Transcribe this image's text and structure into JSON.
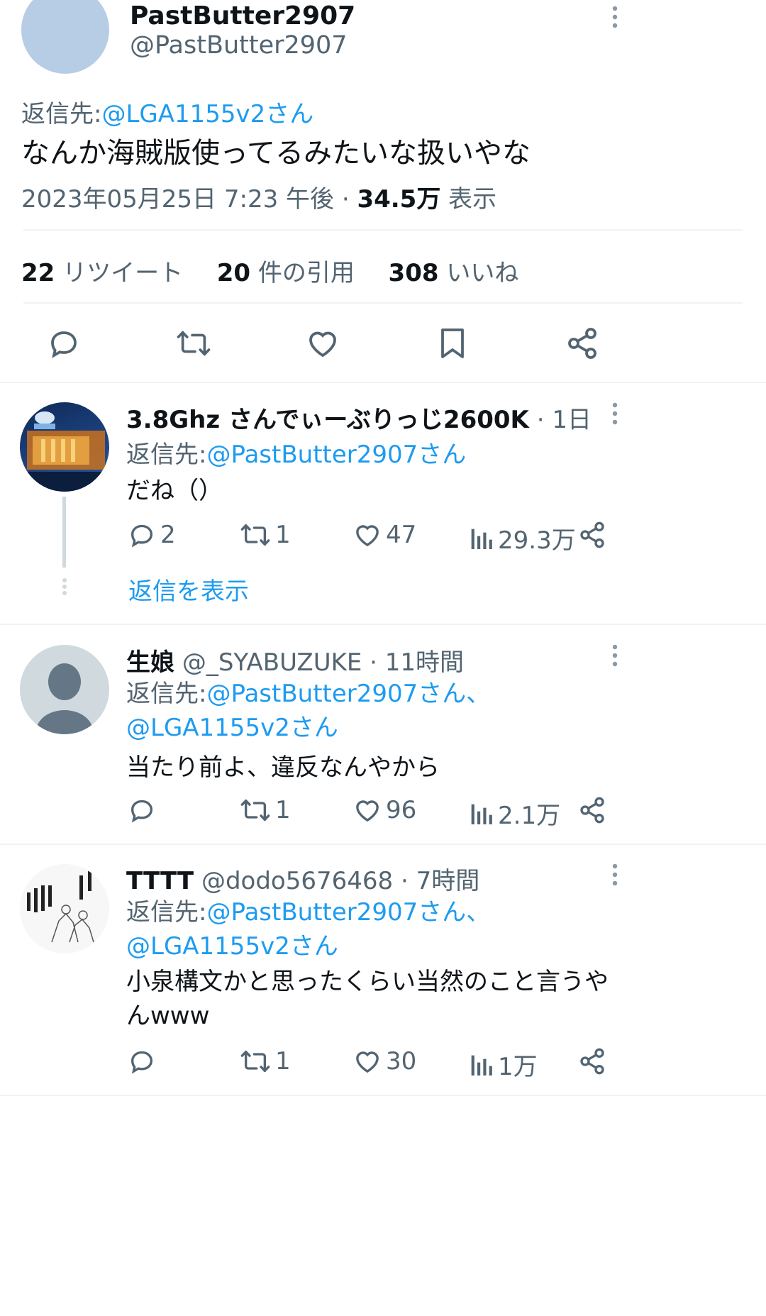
{
  "main_tweet": {
    "display_name": "PastButter2907",
    "handle": "@PastButter2907",
    "reply_prefix": "返信先:",
    "reply_target": "@LGA1155v2さん",
    "text": "なんか海賊版使ってるみたいな扱いやな",
    "timestamp": "2023年05月25日 7:23 午後 · ",
    "views_count": "34.5万",
    "views_label": " 表示",
    "stats": {
      "retweets_count": "22",
      "retweets_label": "リツイート",
      "quotes_count": "20",
      "quotes_label": "件の引用",
      "likes_count": "308",
      "likes_label": "いいね"
    },
    "icons": [
      "reply-icon",
      "retweet-icon",
      "like-icon",
      "bookmark-icon",
      "share-icon"
    ]
  },
  "replies": [
    {
      "display_name": "3.8Ghz さんでぃーぶりっじ2600K",
      "handle": "",
      "time": "· 1日",
      "reply_prefix": "返信先:",
      "reply_target_1": "@PastButter2907さん",
      "reply_target_2": "",
      "text": "だね（）",
      "reply_count": "2",
      "retweet_count": "1",
      "like_count": "47",
      "view_count": "29.3万",
      "show_replies": "返信を表示"
    },
    {
      "display_name": "生娘",
      "handle": "@_SYABUZUKE",
      "time": "· 11時間",
      "reply_prefix": "返信先:",
      "reply_target_1": "@PastButter2907さん、",
      "reply_target_2": "@LGA1155v2さん",
      "text": "当たり前よ、違反なんやから",
      "reply_count": "",
      "retweet_count": "1",
      "like_count": "96",
      "view_count": "2.1万"
    },
    {
      "display_name": "TTTT",
      "handle": "@dodo5676468",
      "time": "· 7時間",
      "reply_prefix": "返信先:",
      "reply_target_1": "@PastButter2907さん、",
      "reply_target_2": "@LGA1155v2さん",
      "text_line1": "小泉構文かと思ったくらい当然のこと言うや",
      "text_line2": "んwww",
      "reply_count": "",
      "retweet_count": "1",
      "like_count": "30",
      "view_count": "1万"
    }
  ],
  "colors": {
    "text": "#0f1419",
    "secondary": "#536471",
    "accent": "#1d9bf0",
    "divider": "#eff3f4",
    "avatar_main": "#b7cde6",
    "avatar_default": "#cfd9de"
  }
}
